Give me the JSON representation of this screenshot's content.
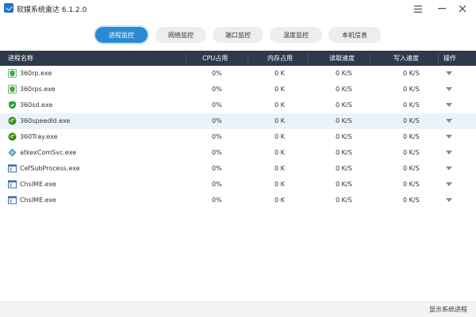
{
  "app": {
    "title": "软媒系统雷达 6.1.2.0",
    "menu_icon": "hamburger-menu-icon",
    "min_icon": "minimize-icon",
    "close_icon": "close-icon"
  },
  "tabs": [
    {
      "label": "进程监控",
      "active": true
    },
    {
      "label": "网络监控",
      "active": false
    },
    {
      "label": "端口监控",
      "active": false
    },
    {
      "label": "温度监控",
      "active": false
    },
    {
      "label": "本机信息",
      "active": false
    }
  ],
  "table": {
    "headers": [
      "进程名称",
      "CPU占用",
      "内存占用",
      "读取速度",
      "写入速度",
      "操作"
    ],
    "rows": [
      {
        "name": "360rp.exe",
        "cpu": "0%",
        "mem": "0 K",
        "read": "0 K/S",
        "write": "0 K/S",
        "icon": "360-shield-icon"
      },
      {
        "name": "360rps.exe",
        "cpu": "0%",
        "mem": "0 K",
        "read": "0 K/S",
        "write": "0 K/S",
        "icon": "360-shield-icon"
      },
      {
        "name": "360sd.exe",
        "cpu": "0%",
        "mem": "0 K",
        "read": "0 K/S",
        "write": "0 K/S",
        "icon": "360-antivirus-icon"
      },
      {
        "name": "360speedld.exe",
        "cpu": "0%",
        "mem": "0 K",
        "read": "0 K/S",
        "write": "0 K/S",
        "icon": "360-speed-icon"
      },
      {
        "name": "360Tray.exe",
        "cpu": "0%",
        "mem": "0 K",
        "read": "0 K/S",
        "write": "0 K/S",
        "icon": "360-tray-icon"
      },
      {
        "name": "atkexComSvc.exe",
        "cpu": "0%",
        "mem": "0 K",
        "read": "0 K/S",
        "write": "0 K/S",
        "icon": "diamond-app-icon"
      },
      {
        "name": "CefSubProcess.exe",
        "cpu": "0%",
        "mem": "0 K",
        "read": "0 K/S",
        "write": "0 K/S",
        "icon": "window-app-icon"
      },
      {
        "name": "ChsIME.exe",
        "cpu": "0%",
        "mem": "0 K",
        "read": "0 K/S",
        "write": "0 K/S",
        "icon": "window-app-icon"
      },
      {
        "name": "ChsIME.exe",
        "cpu": "0%",
        "mem": "0 K",
        "read": "0 K/S",
        "write": "0 K/S",
        "icon": "window-app-icon"
      }
    ],
    "highlighted_row": 3,
    "row_action_icon": "dropdown-arrow-icon"
  },
  "footer": {
    "show_system_label": "显示系统进程"
  },
  "colors": {
    "accent": "#2a8ad3",
    "header_bg": "#2d3a4a",
    "row_highlight": "#eaf3fb"
  }
}
